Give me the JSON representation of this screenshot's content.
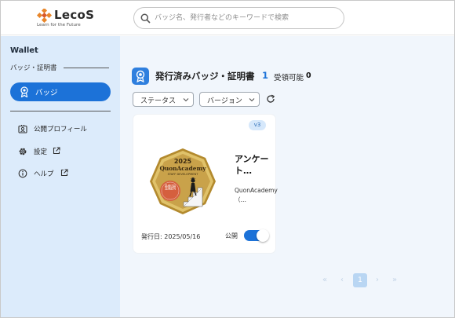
{
  "header": {
    "logo_text": "LecoS",
    "logo_tagline": "Learn for the Future",
    "search_placeholder": "バッジ名、発行者などのキーワードで検索"
  },
  "sidebar": {
    "title": "Wallet",
    "section_label": "バッジ・証明書",
    "active_item": "バッジ",
    "items": [
      {
        "label": "公開プロフィール"
      },
      {
        "label": "設定"
      },
      {
        "label": "ヘルプ"
      }
    ]
  },
  "main": {
    "title": "発行済みバッジ・証明書",
    "issued_count": "1",
    "receivable_label": "受領可能",
    "receivable_count": "0",
    "filters": {
      "status_label": "ステータス",
      "version_label": "バージョン"
    },
    "card": {
      "version": "v3",
      "name": "アンケート…",
      "issuer": "QuonAcademy（…",
      "issued_date": "発行日: 2025/05/16",
      "public_label": "公開",
      "public_enabled": true,
      "medal": {
        "year": "2025",
        "brand": "QuonAcademy",
        "subtitle": "STAFF DEVELOPMENT",
        "stamp": "受講証明"
      }
    },
    "pagination": {
      "first": "«",
      "prev": "‹",
      "current_page": "1",
      "next": "›",
      "last": "»"
    }
  },
  "colors": {
    "accent": "#1c72d8",
    "sidebar_bg": "#dcebfb",
    "main_bg": "#f1f6fc"
  }
}
